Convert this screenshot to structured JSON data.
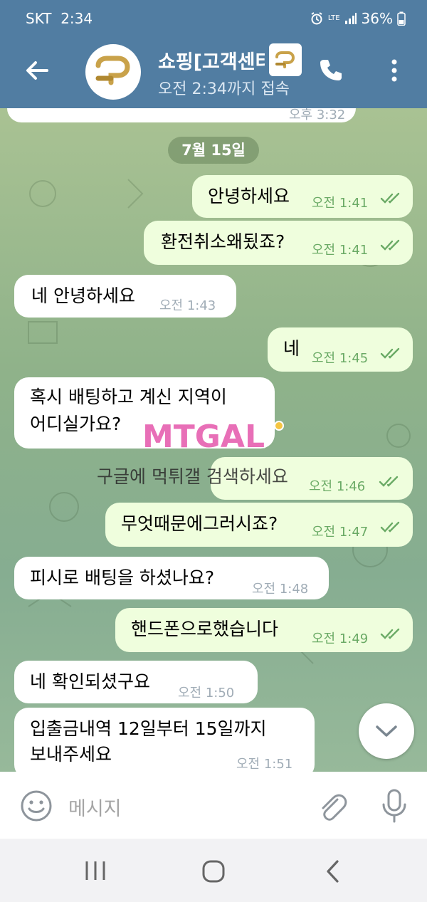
{
  "status": {
    "carrier": "SKT",
    "time": "2:34",
    "lte": "LTE",
    "battery": "36%"
  },
  "header": {
    "title": "쇼핑[고객센터]",
    "subtitle": "오전 2:34까지 접속"
  },
  "chat": {
    "prev_time": "오후 3:32",
    "date": "7월 15일",
    "messages": [
      {
        "dir": "out",
        "text": "안녕하세요",
        "time": "오전 1:41",
        "read": true
      },
      {
        "dir": "out",
        "text": "환전취소왜됬죠?",
        "time": "오전 1:41",
        "read": true
      },
      {
        "dir": "in",
        "text": "네 안녕하세요",
        "time": "오전 1:43"
      },
      {
        "dir": "out",
        "text": "네",
        "time": "오전 1:45",
        "read": true
      },
      {
        "dir": "in",
        "text_line1": "혹시 배팅하고 계신 지역이",
        "text_line2": "어디실가요?",
        "time": ""
      },
      {
        "dir": "out",
        "text": "",
        "time": "오전 1:46",
        "read": true
      },
      {
        "dir": "out",
        "text": "무엇때문에그러시죠?",
        "time": "오전 1:47",
        "read": true
      },
      {
        "dir": "in",
        "text": "피시로 배팅을 하셨나요?",
        "time": "오전 1:48"
      },
      {
        "dir": "out",
        "text": "핸드폰으로했습니다",
        "time": "오전 1:49",
        "read": true
      },
      {
        "dir": "in",
        "text": "네 확인되셨구요",
        "time": "오전 1:50"
      },
      {
        "dir": "in",
        "text_line1": "입출금내역 12일부터 15일까지",
        "text_line2": "보내주세요",
        "time": "오전 1:51"
      }
    ],
    "watermark_logo": "MTGAL",
    "watermark_text": "구글에 먹튀갤 검색하세요"
  },
  "input": {
    "placeholder": "메시지"
  },
  "colors": {
    "header": "#517da2",
    "bubble_out": "#effedd",
    "bubble_in": "#ffffff",
    "check": "#6aaa65"
  }
}
